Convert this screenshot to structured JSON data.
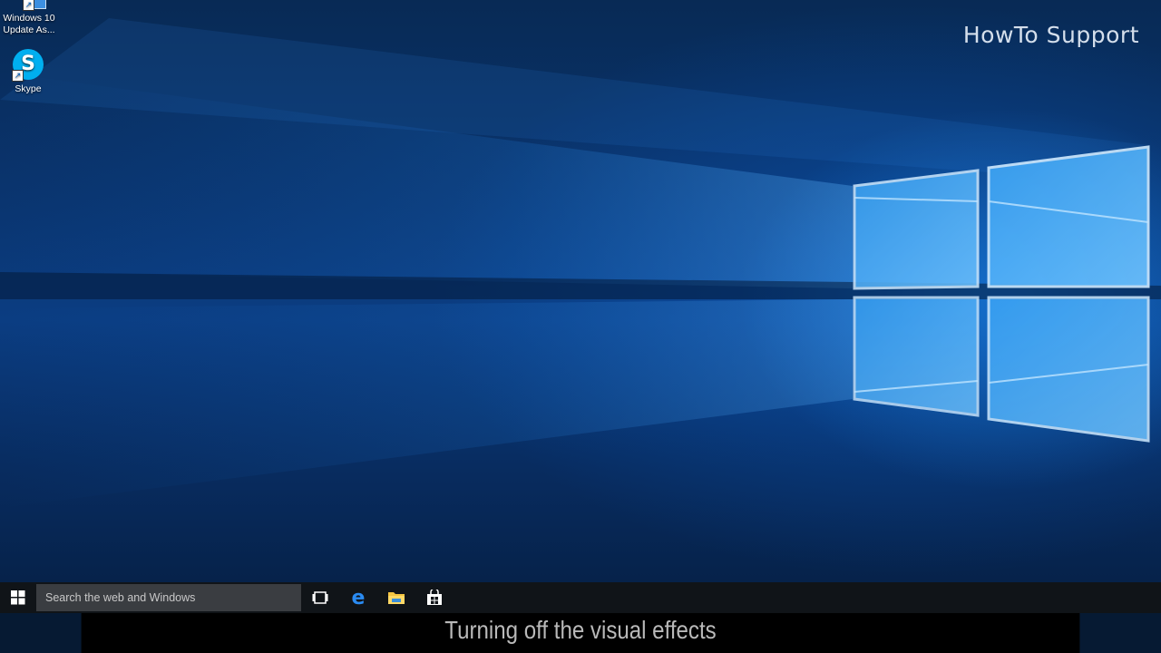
{
  "desktop": {
    "icons": [
      {
        "label": "Windows 10 Update As...",
        "icon": "windows-update-assistant-icon"
      },
      {
        "label": "Skype",
        "icon": "skype-icon"
      }
    ],
    "skype_glyph": "S",
    "watermark": "HowTo Support"
  },
  "taskbar": {
    "start_icon": "windows-start-icon",
    "search_placeholder": "Search the web and Windows",
    "pinned": [
      {
        "name": "task-view",
        "icon": "task-view-icon"
      },
      {
        "name": "edge",
        "icon": "edge-icon",
        "glyph": "e"
      },
      {
        "name": "file-explorer",
        "icon": "folder-icon"
      },
      {
        "name": "store",
        "icon": "store-icon"
      }
    ]
  },
  "caption": "Turning off the visual effects",
  "colors": {
    "accent": "#0a74da",
    "taskbar": "#101418",
    "search": "#3a3d41",
    "skype": "#00aff0"
  }
}
